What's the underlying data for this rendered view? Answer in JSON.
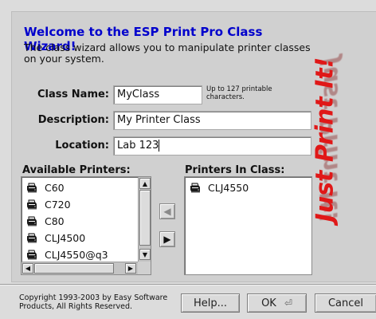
{
  "header": {
    "title": "Welcome to the ESP Print Pro Class Wizard!",
    "intro": "The class wizard allows you to manipulate printer classes on your system."
  },
  "form": {
    "class_name": {
      "label": "Class Name:",
      "value": "MyClass",
      "hint": "Up to 127 printable characters."
    },
    "description": {
      "label": "Description:",
      "value": "My Printer Class"
    },
    "location": {
      "label": "Location:",
      "value": "Lab 123"
    }
  },
  "available": {
    "label": "Available Printers:",
    "items": [
      "C60",
      "C720",
      "C80",
      "CLJ4500",
      "CLJ4550@q3"
    ]
  },
  "in_class": {
    "label": "Printers In Class:",
    "items": [
      "CLJ4550"
    ]
  },
  "move": {
    "left_glyph": "◀",
    "right_glyph": "▶"
  },
  "footer": {
    "copyright": "Copyright 1993-2003 by Easy Software Products, All Rights Reserved.",
    "help_label": "Help...",
    "ok_label": "OK",
    "ok_glyph": "⏎",
    "cancel_label": "Cancel"
  },
  "brand": {
    "slogan": "Just Print It!",
    "color": "#e01818"
  }
}
